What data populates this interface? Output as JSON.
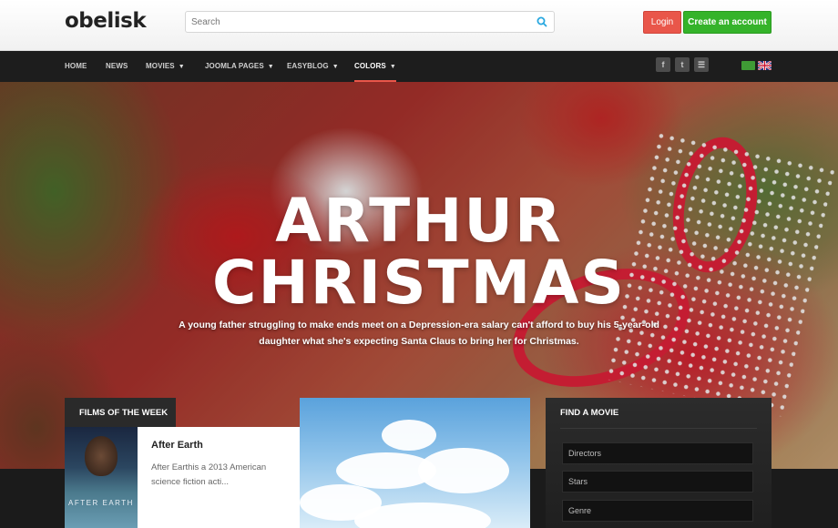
{
  "header": {
    "logo": "obelisk",
    "search_placeholder": "Search",
    "login_label": "Login",
    "create_account_label": "Create an account"
  },
  "nav": {
    "items": [
      {
        "label": "HOME",
        "dropdown": false
      },
      {
        "label": "NEWS",
        "dropdown": false
      },
      {
        "label": "MOVIES",
        "dropdown": true
      },
      {
        "label": "JOOMLA PAGES",
        "dropdown": true
      },
      {
        "label": "EASYBLOG",
        "dropdown": true
      },
      {
        "label": "COLORS",
        "dropdown": true,
        "active": true
      }
    ],
    "caret": "▼",
    "social": [
      "facebook-icon",
      "twitter-icon",
      "rss-icon"
    ],
    "social_glyphs": [
      "f",
      "t",
      "☰"
    ],
    "languages": [
      "arabic-flag",
      "english-flag"
    ]
  },
  "hero": {
    "title_line1": "ARTHUR",
    "title_line2": "CHRISTMAS",
    "subtitle": "A young father struggling to make ends meet on a Depression-era salary can't afford to buy his 5-year-old daughter what she's expecting Santa Claus to bring her for Christmas."
  },
  "films": {
    "heading": "FILMS OF THE WEEK",
    "poster_title": "AFTER EARTH",
    "title": "After Earth",
    "description": "After Earthis a 2013 American science fiction acti..."
  },
  "find": {
    "heading": "FIND A MOVIE",
    "fields": [
      "Directors",
      "Stars",
      "Genre"
    ]
  },
  "colors": {
    "login": "#e9564a",
    "create": "#35b32a",
    "nav_bg": "#1d1d1d",
    "active_underline": "#e9564a"
  }
}
